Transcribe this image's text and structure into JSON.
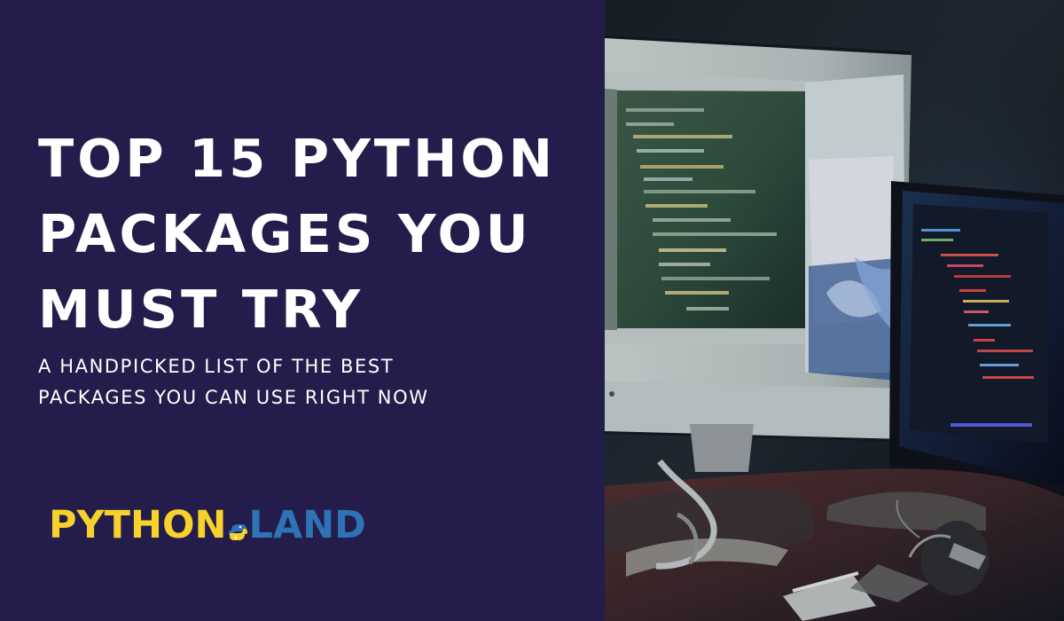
{
  "headline": {
    "line1": "TOP 15 PYTHON",
    "line2": "PACKAGES YOU",
    "line3": "MUST TRY"
  },
  "subtitle": {
    "line1": "A HANDPICKED LIST OF THE BEST",
    "line2": "PACKAGES YOU CAN USE RIGHT NOW"
  },
  "logo": {
    "python": "PYTHON",
    "land": "LAND",
    "colors": {
      "python": "#f7d12c",
      "land": "#2f72b6"
    },
    "mark_icon": "python-logo-icon"
  },
  "photo": {
    "icon": "computer-monitors-photo"
  },
  "colors": {
    "background": "#241d4b",
    "text": "#ffffff"
  }
}
